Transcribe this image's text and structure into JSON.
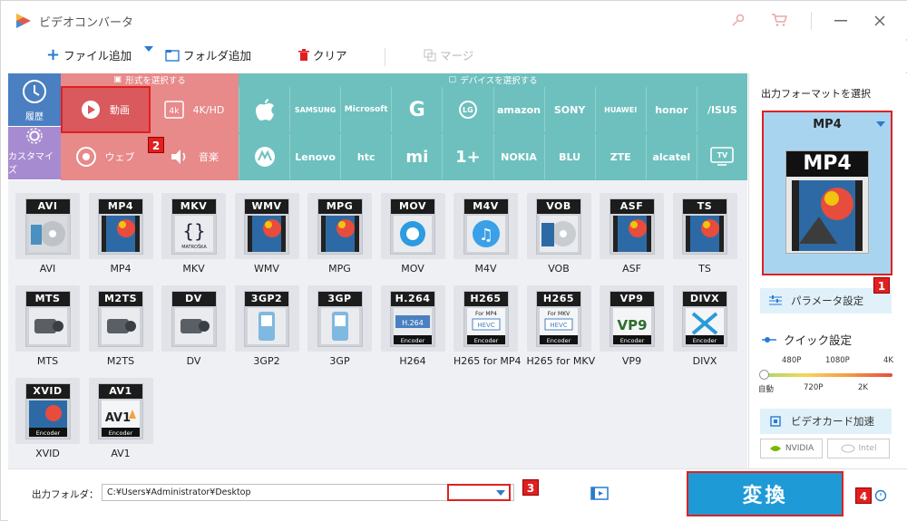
{
  "app": {
    "title": "ビデオコンバータ"
  },
  "toolbar": {
    "add_file": "ファイル追加",
    "add_folder": "フォルダ追加",
    "clear": "クリア",
    "merge": "マージ"
  },
  "left_nav": {
    "history": "履歴",
    "customize": "カスタマイズ"
  },
  "categories": {
    "format_header": "形式を選択する",
    "device_header": "デバイスを選択する",
    "video": "動画",
    "hd": "4K/HD",
    "web": "ウェブ",
    "audio": "音楽"
  },
  "devices": [
    "",
    "SAMSUNG",
    "Microsoft",
    "G",
    "LG",
    "amazon",
    "SONY",
    "HUAWEI",
    "honor",
    "/ISUS",
    "",
    "Lenovo",
    "htc",
    "mi",
    "1+",
    "NOKIA",
    "BLU",
    "ZTE",
    "alcatel",
    "TV"
  ],
  "formats": [
    {
      "label": "AVI",
      "band": "AVI"
    },
    {
      "label": "MP4",
      "band": "MP4"
    },
    {
      "label": "MKV",
      "band": "MKV"
    },
    {
      "label": "WMV",
      "band": "WMV"
    },
    {
      "label": "MPG",
      "band": "MPG"
    },
    {
      "label": "MOV",
      "band": "MOV"
    },
    {
      "label": "M4V",
      "band": "M4V"
    },
    {
      "label": "VOB",
      "band": "VOB"
    },
    {
      "label": "ASF",
      "band": "ASF"
    },
    {
      "label": "TS",
      "band": "TS"
    },
    {
      "label": "MTS",
      "band": "MTS"
    },
    {
      "label": "M2TS",
      "band": "M2TS"
    },
    {
      "label": "DV",
      "band": "DV"
    },
    {
      "label": "3GP2",
      "band": "3GP2"
    },
    {
      "label": "3GP",
      "band": "3GP"
    },
    {
      "label": "H264",
      "band": "H.264"
    },
    {
      "label": "H265 for MP4",
      "band": "H265"
    },
    {
      "label": "H265 for MKV",
      "band": "H265"
    },
    {
      "label": "VP9",
      "band": "VP9"
    },
    {
      "label": "DIVX",
      "band": "DIVX"
    },
    {
      "label": "XVID",
      "band": "XVID"
    },
    {
      "label": "AV1",
      "band": "AV1"
    }
  ],
  "format_subtexts": {
    "matroska": "MATROŠKA",
    "encoder": "Encoder",
    "h264": "H.264",
    "for_mp4": "For MP4",
    "for_mkv": "For MKV",
    "hevc": "HEVC",
    "vp9": "VP9",
    "av1": "AV1"
  },
  "right_panel": {
    "output_format_label": "出力フォーマットを選択",
    "selected_format": "MP4",
    "preview_band": "MP4",
    "param_button": "パラメータ設定",
    "quick_label": "クイック設定",
    "quality_top": [
      "480P",
      "1080P",
      "4K"
    ],
    "quality_bottom": [
      "自動",
      "720P",
      "2K"
    ],
    "gpu_button": "ビデオカード加速",
    "nvidia": "NVIDIA",
    "intel": "Intel"
  },
  "bottom": {
    "output_folder_label": "出力フォルダ：",
    "output_path": "C:¥Users¥Administrator¥Desktop",
    "convert": "変換"
  },
  "badges": [
    "1",
    "2",
    "3",
    "4"
  ],
  "colors": {
    "red_panel": "#e8898a",
    "teal_panel": "#6dc0be",
    "blue_nav": "#4a7fc1",
    "purple_nav": "#a78bd0",
    "convert_blue": "#1e9bd7",
    "highlight_red": "#e02020"
  }
}
